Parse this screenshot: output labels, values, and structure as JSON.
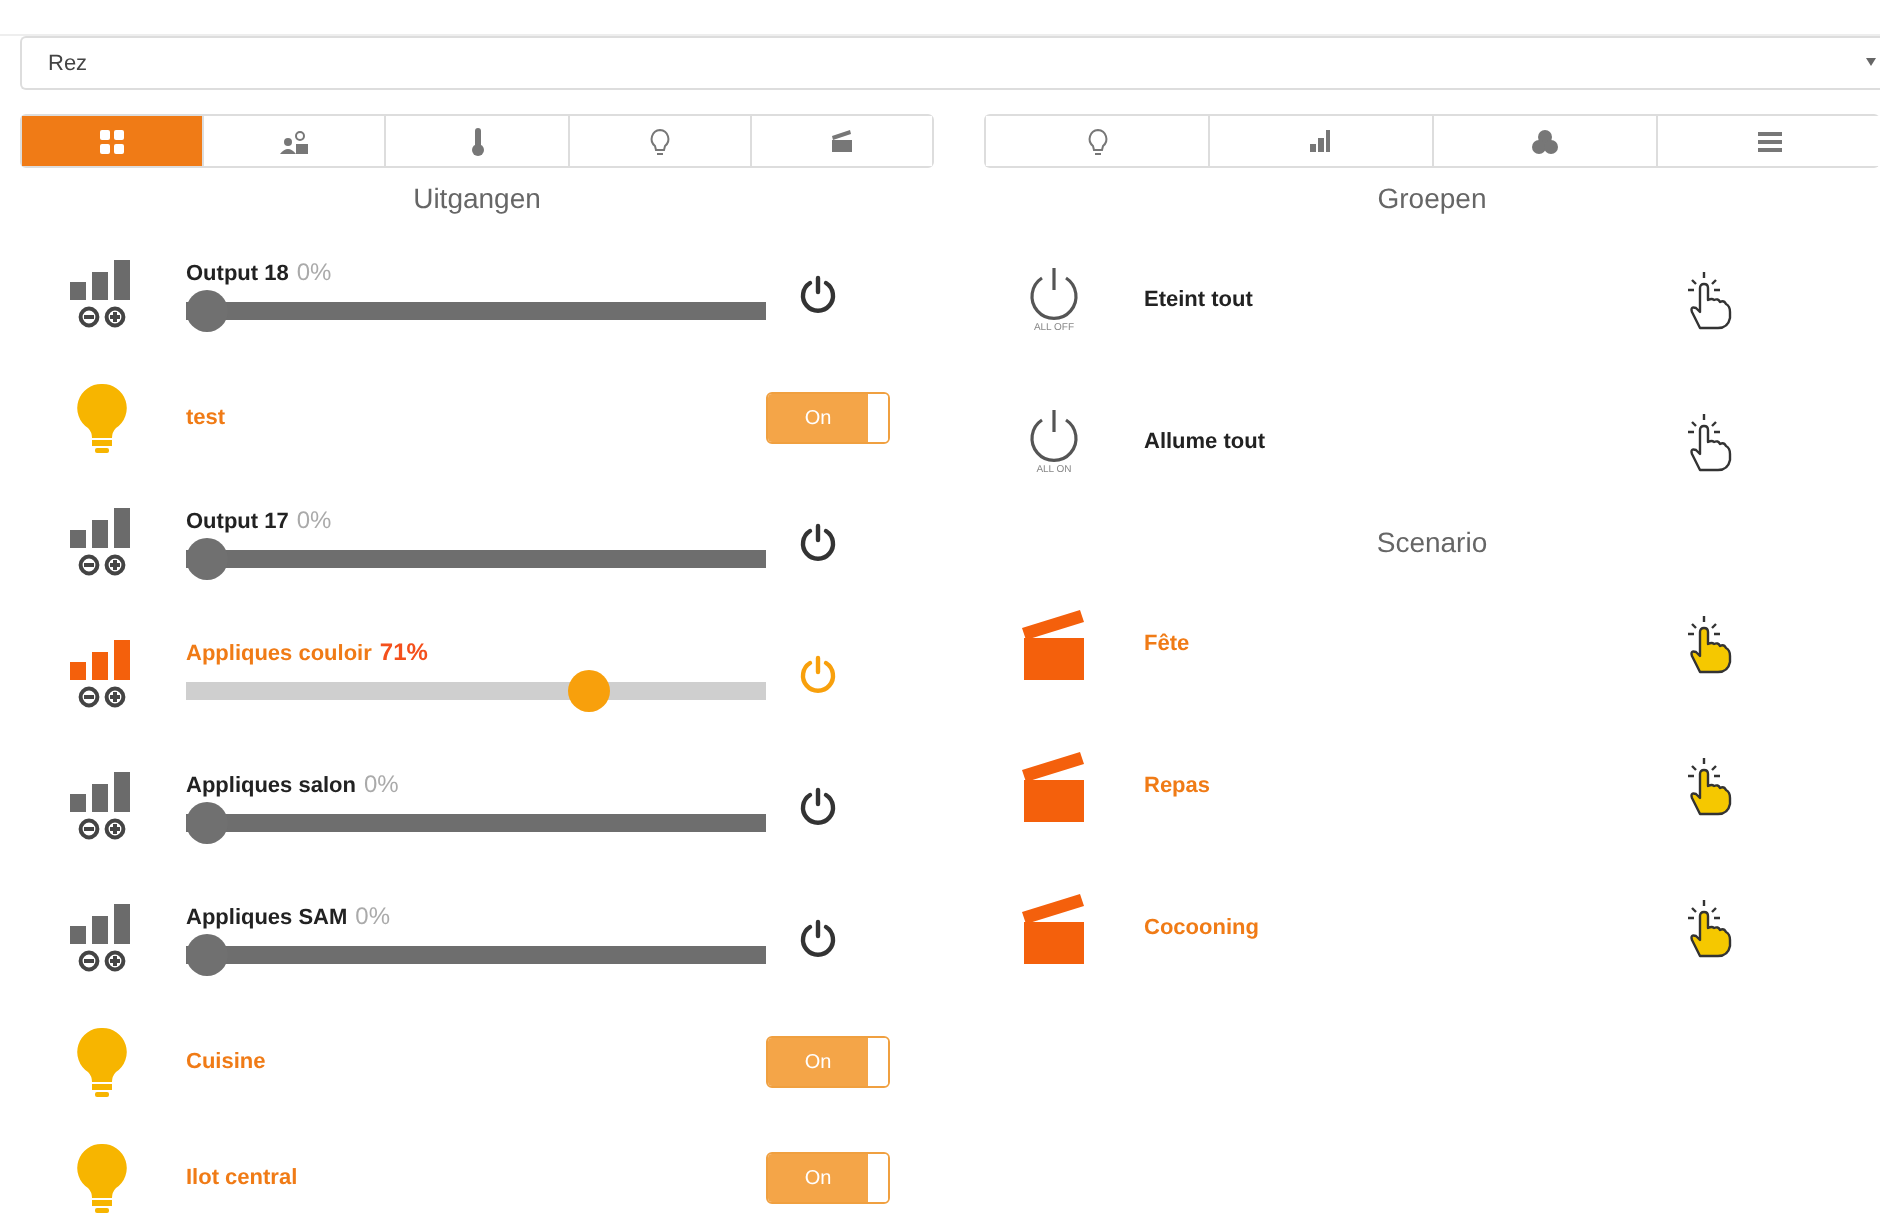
{
  "floor_select": {
    "value": "Rez"
  },
  "left_tabs": [
    {
      "selected": true
    },
    {
      "selected": false
    },
    {
      "selected": false
    },
    {
      "selected": false
    },
    {
      "selected": false
    }
  ],
  "right_tabs": [
    {
      "selected": false
    },
    {
      "selected": false
    },
    {
      "selected": false
    },
    {
      "selected": false
    }
  ],
  "outputs_title": "Uitgangen",
  "outputs": [
    {
      "kind": "dimmer",
      "name": "Output 18",
      "reading": "0%",
      "on": false,
      "level": 0
    },
    {
      "kind": "switch",
      "name": "test",
      "toggle": "On",
      "on": true
    },
    {
      "kind": "dimmer",
      "name": "Output 17",
      "reading": "0%",
      "on": false,
      "level": 0
    },
    {
      "kind": "dimmer",
      "name": "Appliques couloir",
      "reading": "71%",
      "on": true,
      "level": 0.71
    },
    {
      "kind": "dimmer",
      "name": "Appliques salon",
      "reading": "0%",
      "on": false,
      "level": 0
    },
    {
      "kind": "dimmer",
      "name": "Appliques SAM",
      "reading": "0%",
      "on": false,
      "level": 0
    },
    {
      "kind": "switch",
      "name": "Cuisine",
      "toggle": "On",
      "on": true
    },
    {
      "kind": "switch",
      "name": "Ilot central",
      "toggle": "On",
      "on": true
    }
  ],
  "groups_title": "Groepen",
  "groups": [
    {
      "name": "Eteint tout",
      "caption": "ALL OFF"
    },
    {
      "name": "Allume tout",
      "caption": "ALL ON"
    }
  ],
  "scenario_title": "Scenario",
  "scenarios": [
    {
      "name": "Fête"
    },
    {
      "name": "Repas"
    },
    {
      "name": "Cocooning"
    }
  ]
}
